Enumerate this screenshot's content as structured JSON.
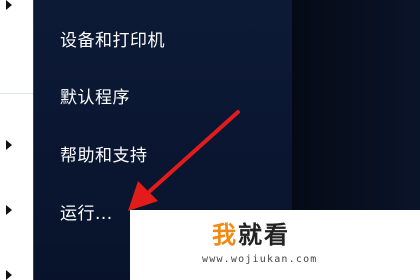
{
  "start_menu": {
    "items": [
      {
        "label": "设备和打印机"
      },
      {
        "label": "默认程序"
      },
      {
        "label": "帮助和支持"
      },
      {
        "label": "运行..."
      }
    ]
  },
  "watermark": {
    "logo_part1": "我",
    "logo_part2": "就看",
    "url": "www.wojiukan.com"
  },
  "colors": {
    "menu_background": "#0b1732",
    "menu_text": "#ffffff",
    "arrow": "#e21b1b",
    "watermark_accent": "#f08a14"
  },
  "icons": [
    "submenu-arrow-icon",
    "pointer-arrow-annotation"
  ]
}
